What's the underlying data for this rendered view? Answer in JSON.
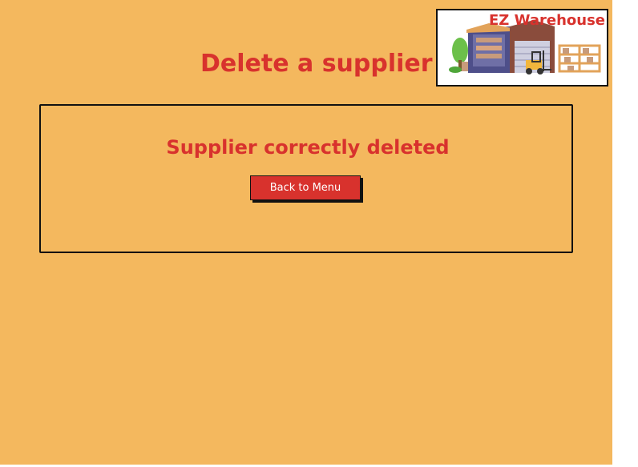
{
  "page": {
    "title": "Delete a supplier"
  },
  "logo": {
    "text": "EZ Warehouse"
  },
  "result": {
    "message": "Supplier correctly deleted",
    "back_button_label": "Back to Menu"
  },
  "colors": {
    "background": "#F4B85E",
    "accent": "#D8322D",
    "button_text": "#FFFFFF"
  }
}
